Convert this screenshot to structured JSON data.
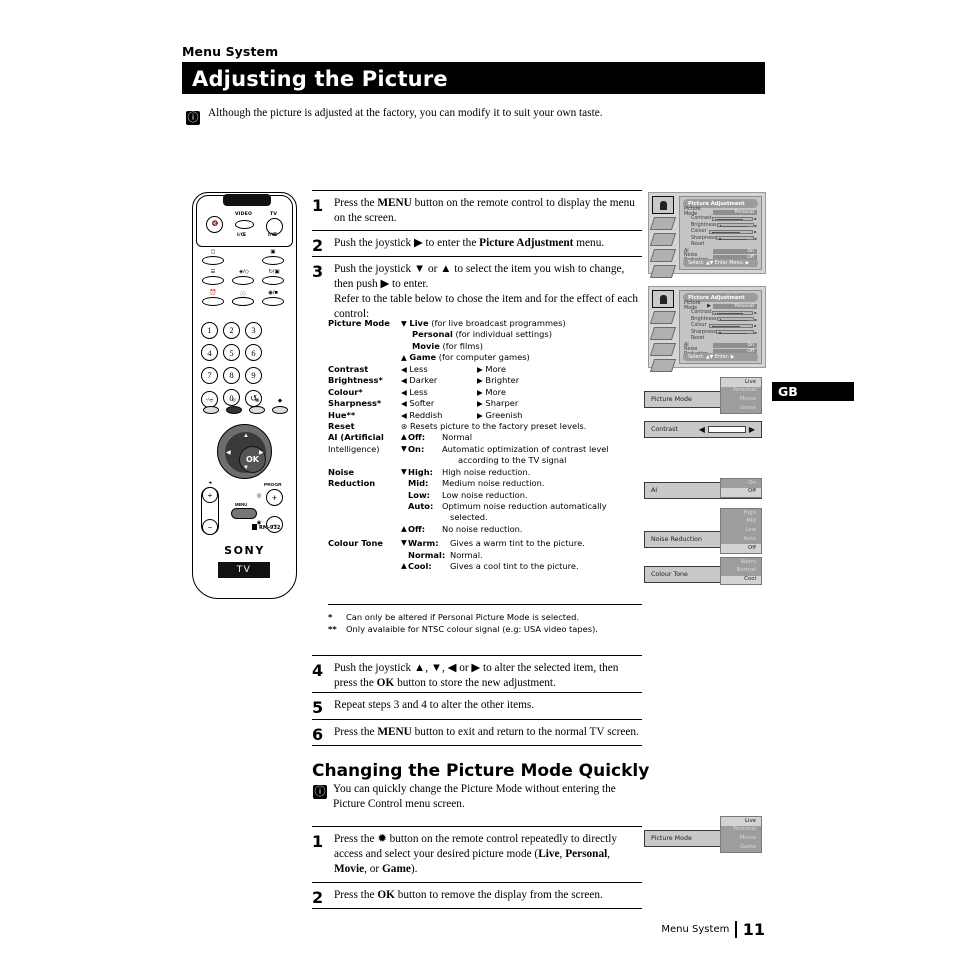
{
  "header": {
    "kicker": "Menu System",
    "title": "Adjusting the Picture",
    "intro": "Although the picture is adjusted at the factory, you can modify it to suit your own taste."
  },
  "steps": [
    {
      "num": "1",
      "text_html": "Press the MENU button on the remote control to display the menu on the screen."
    },
    {
      "num": "2",
      "text_html": "Push the joystick ▶ to enter the Picture Adjustment menu."
    },
    {
      "num": "3",
      "text_html": "Push the joystick ▼ or ▲ to select the item you wish to change, then push ▶ to enter. Refer to the table below to chose the item and for the effect of each control:"
    }
  ],
  "steps2": [
    {
      "num": "4",
      "text_html": "Push the joystick ▲, ▼, ◀ or ▶ to alter the selected item, then press the OK button to store the new adjustment."
    },
    {
      "num": "5",
      "text_html": "Repeat steps 3 and 4 to alter the other items."
    },
    {
      "num": "6",
      "text_html": "Press the MENU button to exit and return to the normal TV screen."
    }
  ],
  "table": {
    "picture_mode": {
      "label": "Picture Mode",
      "options": [
        {
          "arrow": "▼",
          "name": "Live",
          "desc": "(for live broadcast programmes)"
        },
        {
          "arrow": "",
          "name": "Personal",
          "desc": "(for individual settings)"
        },
        {
          "arrow": "",
          "name": "Movie",
          "desc": "(for films)"
        },
        {
          "arrow": "▲",
          "name": "Game",
          "desc": "(for computer games)"
        }
      ]
    },
    "simple_rows": [
      {
        "label": "Contrast",
        "left_arrow": "◀",
        "left": "Less",
        "right_arrow": "▶",
        "right": "More"
      },
      {
        "label": "Brightness*",
        "left_arrow": "◀",
        "left": "Darker",
        "right_arrow": "▶",
        "right": "Brighter"
      },
      {
        "label": "Colour*",
        "left_arrow": "◀",
        "left": "Less",
        "right_arrow": "▶",
        "right": "More"
      },
      {
        "label": "Sharpness*",
        "left_arrow": "◀",
        "left": "Softer",
        "right_arrow": "▶",
        "right": "Sharper"
      },
      {
        "label": "Hue**",
        "left_arrow": "◀",
        "left": "Reddish",
        "right_arrow": "▶",
        "right": "Greenish"
      }
    ],
    "reset": {
      "label": "Reset",
      "icon": "⊛",
      "desc": "Resets picture to the factory preset levels."
    },
    "ai": {
      "label_line1": "AI (Artificial",
      "label_line2": "Intelligence)",
      "options": [
        {
          "arrow": "▲",
          "key": "Off:",
          "desc": "Normal"
        },
        {
          "arrow": "▼",
          "key": "On:",
          "desc": "Automatic optimization of contrast level"
        },
        {
          "arrow": "",
          "key": "",
          "desc": "according to the TV signal"
        }
      ]
    },
    "noise": {
      "label_line1": "Noise",
      "label_line2": "Reduction",
      "options": [
        {
          "arrow": "▼",
          "key": "High:",
          "desc": "High noise reduction."
        },
        {
          "arrow": "",
          "key": "Mid:",
          "desc": "Medium noise reduction."
        },
        {
          "arrow": "",
          "key": "Low:",
          "desc": "Low noise reduction."
        },
        {
          "arrow": "",
          "key": "Auto:",
          "desc": "Optimum noise reduction automatically"
        },
        {
          "arrow": "",
          "key": "",
          "desc": "selected."
        },
        {
          "arrow": "▲",
          "key": "Off:",
          "desc": "No noise reduction."
        }
      ]
    },
    "colour_tone": {
      "label": "Colour Tone",
      "options": [
        {
          "arrow": "▼",
          "key": "Warm:",
          "desc": "Gives a warm tint to the picture."
        },
        {
          "arrow": "",
          "key": "Normal:",
          "desc": "Normal."
        },
        {
          "arrow": "▲",
          "key": "Cool:",
          "desc": "Gives a cool tint to the picture."
        }
      ]
    },
    "footnotes": [
      {
        "mark": "*",
        "text": "Can only be altered if Personal Picture Mode is selected."
      },
      {
        "mark": "**",
        "text": "Only avalaible for NTSC colour signal (e.g: USA video tapes)."
      }
    ]
  },
  "section2": {
    "heading": "Changing the Picture Mode Quickly",
    "note": "You can quickly change the Picture Mode without entering the Picture Control menu screen.",
    "steps": [
      {
        "num": "1",
        "text_html": "Press the ✹ button on the remote control repeatedly to directly access and select your desired picture mode (Live, Personal, Movie, or Game)."
      },
      {
        "num": "2",
        "text_html": "Press the OK button to remove the display from the screen."
      }
    ]
  },
  "osd": {
    "title": "Picture Adjustment",
    "rows": [
      {
        "name": "Picture Mode",
        "value": "Personal",
        "type": "value",
        "indent": false
      },
      {
        "name": "Contrast",
        "type": "slider",
        "indent": true
      },
      {
        "name": "Brightness",
        "type": "slider",
        "indent": true
      },
      {
        "name": "Colour",
        "type": "slider",
        "indent": true
      },
      {
        "name": "Sharpness",
        "type": "slider",
        "indent": true
      },
      {
        "name": "Reset",
        "type": "none",
        "indent": true
      },
      {
        "name": "AI",
        "value": "On",
        "type": "value",
        "indent": false
      },
      {
        "name": "Noise Reduction",
        "value": "Off",
        "type": "value",
        "indent": false
      },
      {
        "name": "Colour Tone",
        "value": "Normal",
        "type": "value",
        "indent": false
      }
    ],
    "footer_a": "Select: ▲▼   Enter Menu: ▶",
    "footer_b": "Select: ▲▼   Enter: ▶"
  },
  "option_boxes": [
    {
      "name": "Picture Mode",
      "kind": "dropdown",
      "options": [
        "Live",
        "Personal",
        "Movie",
        "Game"
      ],
      "selected": "Live"
    },
    {
      "name": "Contrast",
      "kind": "slider",
      "left_arrow": "◀",
      "right_arrow": "▶"
    },
    {
      "name": "AI",
      "kind": "dropdown",
      "options": [
        "On",
        "Off"
      ],
      "selected": "Off"
    },
    {
      "name": "Noise Reduction",
      "kind": "dropdown",
      "options": [
        "High",
        "Mid",
        "Low",
        "Auto",
        "Off"
      ],
      "selected": "Off"
    },
    {
      "name": "Colour Tone",
      "kind": "dropdown",
      "options": [
        "Warm",
        "Normal",
        "Cool"
      ],
      "selected": "Cool"
    },
    {
      "name": "Picture Mode",
      "kind": "dropdown",
      "options": [
        "Live",
        "Personal",
        "Movie",
        "Game"
      ],
      "selected": "Live"
    }
  ],
  "language_tab": "GB",
  "footer": {
    "label": "Menu System",
    "page": "11"
  },
  "remote": {
    "brand": "SONY",
    "tv_badge": "TV",
    "model": "RM-932",
    "label_video": "VIDEO",
    "label_tv": "TV",
    "label_power_video": "I/Œ",
    "label_power_tv": "I/Œ",
    "label_progr": "PROGR",
    "label_menu": "MENU",
    "label_ok": "OK",
    "keys": [
      "1",
      "2",
      "3",
      "4",
      "5",
      "6",
      "7",
      "8",
      "9",
      "-/--",
      "0",
      "↺"
    ]
  }
}
